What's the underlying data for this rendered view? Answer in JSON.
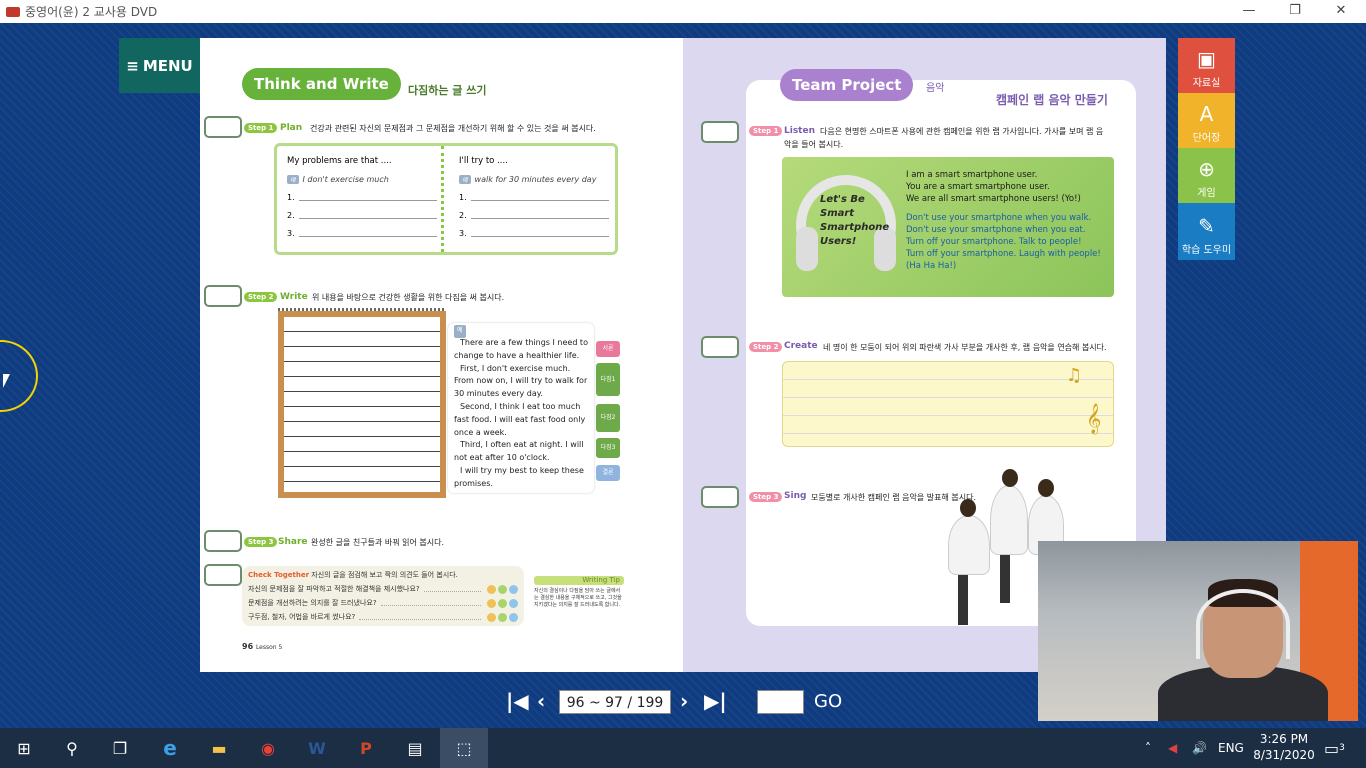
{
  "window": {
    "title": "중영어(윤) 2 교사용 DVD",
    "minimize": "—",
    "restore": "❐",
    "close": "✕"
  },
  "menu": {
    "label": "MENU",
    "icon": "hamburger-icon"
  },
  "side_tools": [
    {
      "label": "자료실",
      "icon": "archive-icon"
    },
    {
      "label": "단어장",
      "icon": "word-book-icon"
    },
    {
      "label": "게임",
      "icon": "gamepad-icon"
    },
    {
      "label": "학습 도우미",
      "icon": "lamp-icon"
    }
  ],
  "left_page": {
    "header": "Think and Write",
    "header_sub": "다짐하는 글 쓰기",
    "step1": {
      "badge": "Step 1",
      "name": "Plan",
      "text": "건강과 관련된 자신의 문제점과 그 문제점을 개선하기 위해 할 수 있는 것을 써 봅시다."
    },
    "problems_col": {
      "title": "My problems are that ....",
      "ex_tag": "예",
      "example": "I don't exercise much",
      "n1": "1.",
      "n2": "2.",
      "n3": "3."
    },
    "try_col": {
      "title": "I'll try to ....",
      "ex_tag": "예",
      "example": "walk for 30 minutes every day",
      "n1": "1.",
      "n2": "2.",
      "n3": "3."
    },
    "step2": {
      "badge": "Step 2",
      "name": "Write",
      "text": "위 내용을 바탕으로 건강한 생활을 위한 다짐을 써 봅시다."
    },
    "sample_tag": "예",
    "sample": [
      "There are a few things I need to change to have a healthier life.",
      "First, I don't exercise much. From now on, I will try to walk for 30 minutes every day.",
      "Second, I think I eat too much fast food. I will eat fast food only once a week.",
      "Third, I often eat at night. I will not eat after 10 o'clock.",
      "I will try my best to keep these promises."
    ],
    "side_tabs": [
      "서론",
      "다짐1",
      "다짐2",
      "다짐3",
      "결론"
    ],
    "step3": {
      "badge": "Step 3",
      "name": "Share",
      "text": "완성한 글을 친구들과 바꿔 읽어 봅시다."
    },
    "check": {
      "title": "Check Together",
      "subtitle": "자신의 글을 점검해 보고 짝의 의견도 들어 봅시다.",
      "items": [
        "자신의 문제점을 잘 파악하고 적절한 해결책을 제시했나요?",
        "문제점을 개선하려는 의지를 잘 드러냈나요?",
        "구두점, 철자, 어법을 바르게 썼나요?"
      ]
    },
    "tip": {
      "head": "Writing Tip",
      "text": "자신의 결심이나 다짐을 담아 쓰는 글에서는 결심한 내용을 구체적으로 쓰고, 그것을 지키겠다는 의지를 잘 드러내도록 합니다."
    },
    "page_no": "96",
    "lesson": "Lesson 5"
  },
  "right_page": {
    "header": "Team Project",
    "header_tag": "음악",
    "header_sub": "캠페인 랩 음악 만들기",
    "step1": {
      "badge": "Step 1",
      "name": "Listen",
      "text": "다음은 현명한 스마트폰 사용에 관한 캠페인을 위한 랩 가사입니다. 가사를 보며 랩 음",
      "text2": "악을 들어 봅시다."
    },
    "poster": "Let's Be Smart Smartphone Users!",
    "lyrics_a": [
      "I am a smart smartphone user.",
      "You are a smart smartphone user.",
      "We are all smart smartphone users! (Yo!)"
    ],
    "lyrics_b": [
      "Don't use your smartphone when you walk.",
      "Don't use your smartphone when you eat.",
      "Turn off your smartphone. Talk to people!",
      "Turn off your smartphone. Laugh with people!",
      "(Ha Ha Ha!)"
    ],
    "step2": {
      "badge": "Step 2",
      "name": "Create",
      "text": "네 명이 한 모둠이 되어 위의 파란색 가사 부분을 개사한 후, 랩 음악을 연습해 봅시다."
    },
    "step3": {
      "badge": "Step 3",
      "name": "Sing",
      "text": "모둠별로 개사한 캠페인 랩 음악을 발표해 봅시다."
    }
  },
  "pager": {
    "page_display": "96 ~ 97 / 199",
    "go_label": "GO",
    "first_icon": "first-page-icon",
    "prev_icon": "prev-page-icon",
    "next_icon": "next-page-icon",
    "last_icon": "last-page-icon"
  },
  "taskbar": {
    "apps": [
      "start-icon",
      "search-icon",
      "task-view-icon",
      "edge-icon",
      "file-explorer-icon",
      "chrome-icon",
      "word-icon",
      "powerpoint-icon",
      "textbook-app-icon",
      "snipping-tool-icon"
    ],
    "lang": "ENG",
    "time": "3:26 PM",
    "date": "8/31/2020",
    "notifications": "3"
  },
  "colors": {
    "bg": "#0f3b80",
    "menu": "#126660",
    "left_green": "#8cc63f",
    "right_purple": "#7a5cb0"
  }
}
